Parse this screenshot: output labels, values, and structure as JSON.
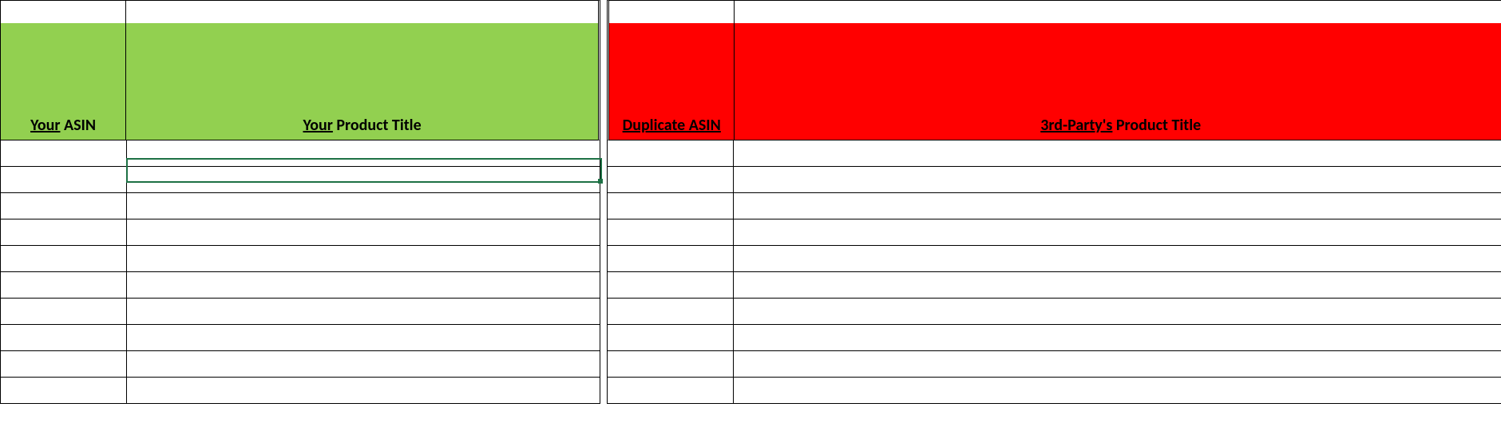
{
  "headers": {
    "left": {
      "asin": {
        "underlined": "Your",
        "rest": " ASIN"
      },
      "title": {
        "underlined": "Your",
        "rest": " Product Title"
      }
    },
    "right": {
      "asin": {
        "underlined": "Duplicate ASIN",
        "rest": ""
      },
      "title": {
        "underlined": "3rd-Party's",
        "rest": " Product Title"
      }
    }
  },
  "colors": {
    "green": "#92d050",
    "red": "#ff0000",
    "selection": "#1e7145"
  },
  "rows": {
    "count": 10
  },
  "selection": {
    "row": 1,
    "col": "title-left"
  }
}
